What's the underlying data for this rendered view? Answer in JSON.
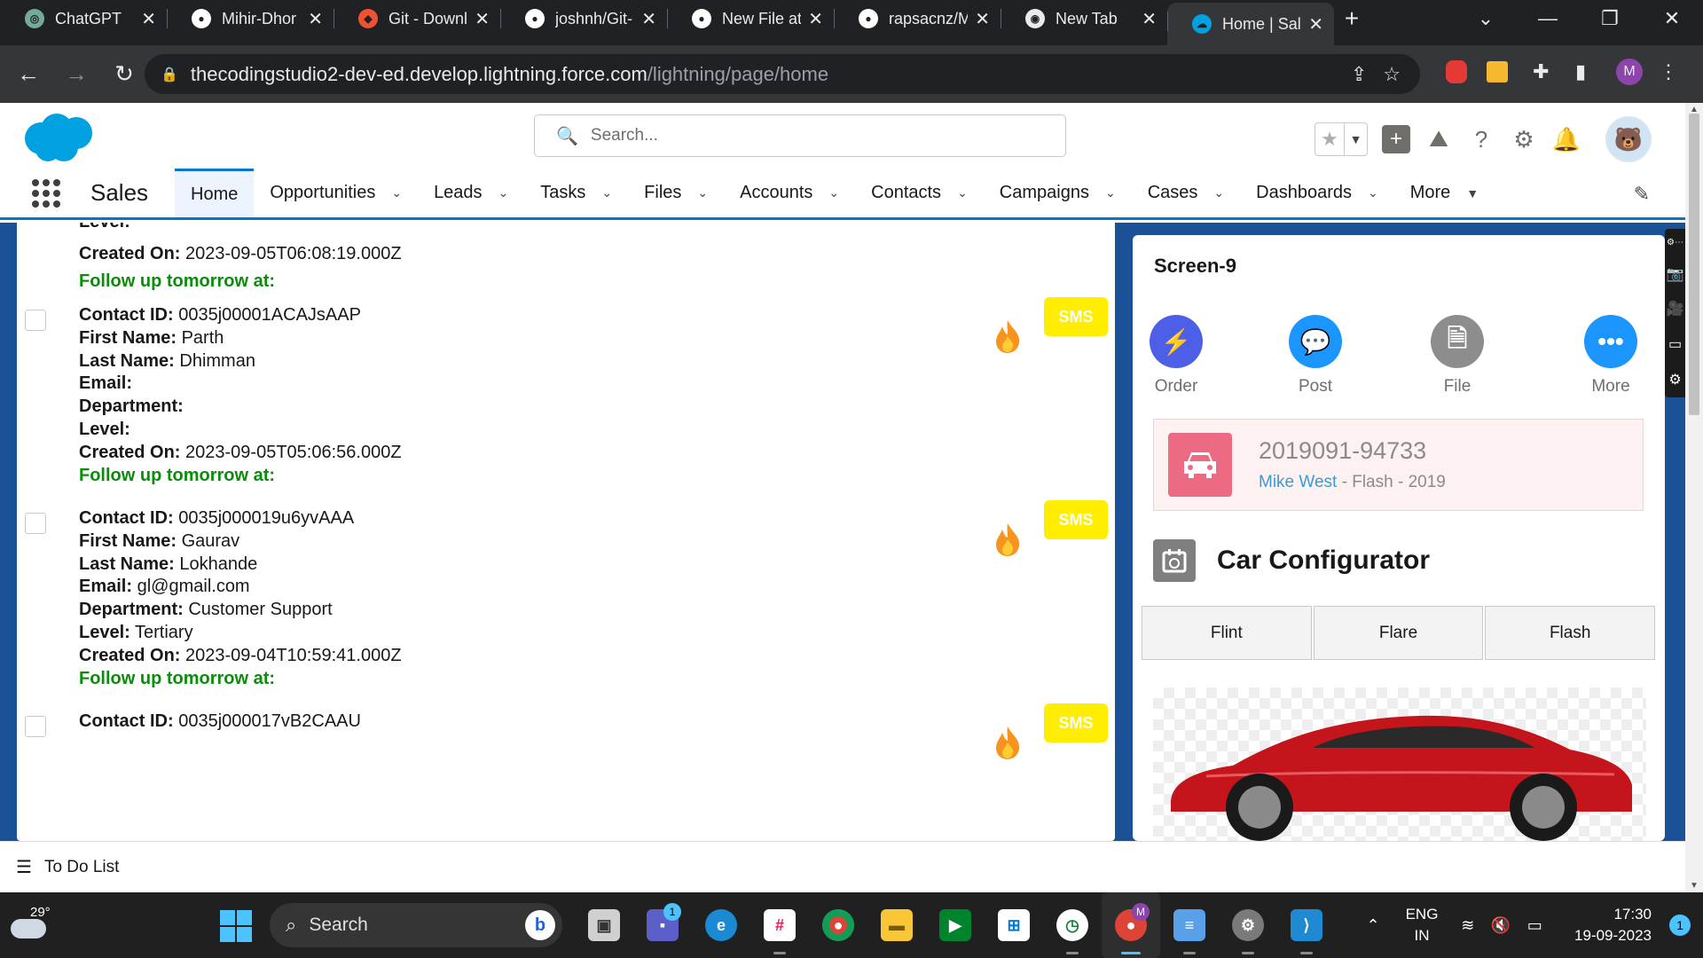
{
  "browser": {
    "tabs": [
      {
        "title": "ChatGPT",
        "favicon_color": "#74aa9c",
        "favicon_icon": "chatgpt-icon",
        "glyph": "◎",
        "active": false
      },
      {
        "title": "Mihir-Dhor",
        "favicon_color": "#ffffff",
        "favicon_icon": "github-icon",
        "glyph": "●",
        "active": false
      },
      {
        "title": "Git - Downl",
        "favicon_color": "#f05133",
        "favicon_icon": "git-icon",
        "glyph": "◆",
        "active": false
      },
      {
        "title": "joshnh/Git-",
        "favicon_color": "#ffffff",
        "favicon_icon": "github-icon",
        "glyph": "●",
        "active": false
      },
      {
        "title": "New File at",
        "favicon_color": "#ffffff",
        "favicon_icon": "github-icon",
        "glyph": "●",
        "active": false
      },
      {
        "title": "rapsacnz/M",
        "favicon_color": "#ffffff",
        "favicon_icon": "github-icon",
        "glyph": "●",
        "active": false
      },
      {
        "title": "New Tab",
        "favicon_color": "#e8eaed",
        "favicon_icon": "chrome-icon",
        "glyph": "◉",
        "active": false
      },
      {
        "title": "Home | Sale",
        "favicon_color": "#00a1e0",
        "favicon_icon": "salesforce-icon",
        "glyph": "☁",
        "active": true
      }
    ],
    "url_host": "thecodingstudio2-dev-ed.develop.lightning.force.com",
    "url_path": "/lightning/page/home",
    "profile_initial": "M"
  },
  "sf_header": {
    "search_placeholder": "Search..."
  },
  "sf_nav": {
    "app_name": "Sales",
    "items": [
      {
        "label": "Home",
        "active": true,
        "has_menu": false
      },
      {
        "label": "Opportunities",
        "active": false,
        "has_menu": true
      },
      {
        "label": "Leads",
        "active": false,
        "has_menu": true
      },
      {
        "label": "Tasks",
        "active": false,
        "has_menu": true
      },
      {
        "label": "Files",
        "active": false,
        "has_menu": true
      },
      {
        "label": "Accounts",
        "active": false,
        "has_menu": true
      },
      {
        "label": "Contacts",
        "active": false,
        "has_menu": true
      },
      {
        "label": "Campaigns",
        "active": false,
        "has_menu": true
      },
      {
        "label": "Cases",
        "active": false,
        "has_menu": true
      },
      {
        "label": "Dashboards",
        "active": false,
        "has_menu": true
      },
      {
        "label": "More",
        "active": false,
        "has_menu": true
      }
    ]
  },
  "field_labels": {
    "contact_id": "Contact ID:",
    "first_name": "First Name:",
    "last_name": "Last Name:",
    "email": "Email:",
    "department": "Department:",
    "level": "Level:",
    "created_on": "Created On:",
    "follow_up": "Follow up tomorrow at:"
  },
  "contacts": {
    "partial_top": {
      "level": "",
      "created_on": "2023-09-05T06:08:19.000Z"
    },
    "records": [
      {
        "contact_id": "0035j00001ACAJsAAP",
        "first_name": "Parth",
        "last_name": "Dhimman",
        "email": "",
        "department": "",
        "level": "",
        "created_on": "2023-09-05T05:06:56.000Z",
        "sms_label": "SMS"
      },
      {
        "contact_id": "0035j000019u6yvAAA",
        "first_name": "Gaurav",
        "last_name": "Lokhande",
        "email": "gl@gmail.com",
        "department": "Customer Support",
        "level": "Tertiary",
        "created_on": "2023-09-04T10:59:41.000Z",
        "sms_label": "SMS"
      },
      {
        "contact_id": "0035j000017vB2CAAU",
        "sms_label": "SMS"
      }
    ]
  },
  "screen_panel": {
    "title": "Screen-9",
    "actions": [
      {
        "label": "Order",
        "color": "#4d5fe6",
        "icon": "lightning-bolt-icon",
        "glyph": "⚡"
      },
      {
        "label": "Post",
        "color": "#1b96ff",
        "icon": "chat-bubble-icon",
        "glyph": "💬"
      },
      {
        "label": "File",
        "color": "#8d8d8d",
        "icon": "file-icon",
        "glyph": "🗎"
      },
      {
        "label": "More",
        "color": "#1b96ff",
        "icon": "more-icon",
        "glyph": "•••"
      }
    ],
    "record": {
      "number": "2019091-94733",
      "owner": "Mike West",
      "rest": " - Flash - 2019"
    },
    "configurator": {
      "title": "Car Configurator",
      "models": [
        "Flint",
        "Flare",
        "Flash"
      ]
    }
  },
  "utility_bar": {
    "label": "To Do List"
  },
  "taskbar": {
    "temperature": "29°",
    "search_label": "Search",
    "lang_top": "ENG",
    "lang_bottom": "IN",
    "time": "17:30",
    "date": "19-09-2023",
    "notification_count": "1",
    "teams_badge": "1",
    "chrome_profile": "M"
  }
}
